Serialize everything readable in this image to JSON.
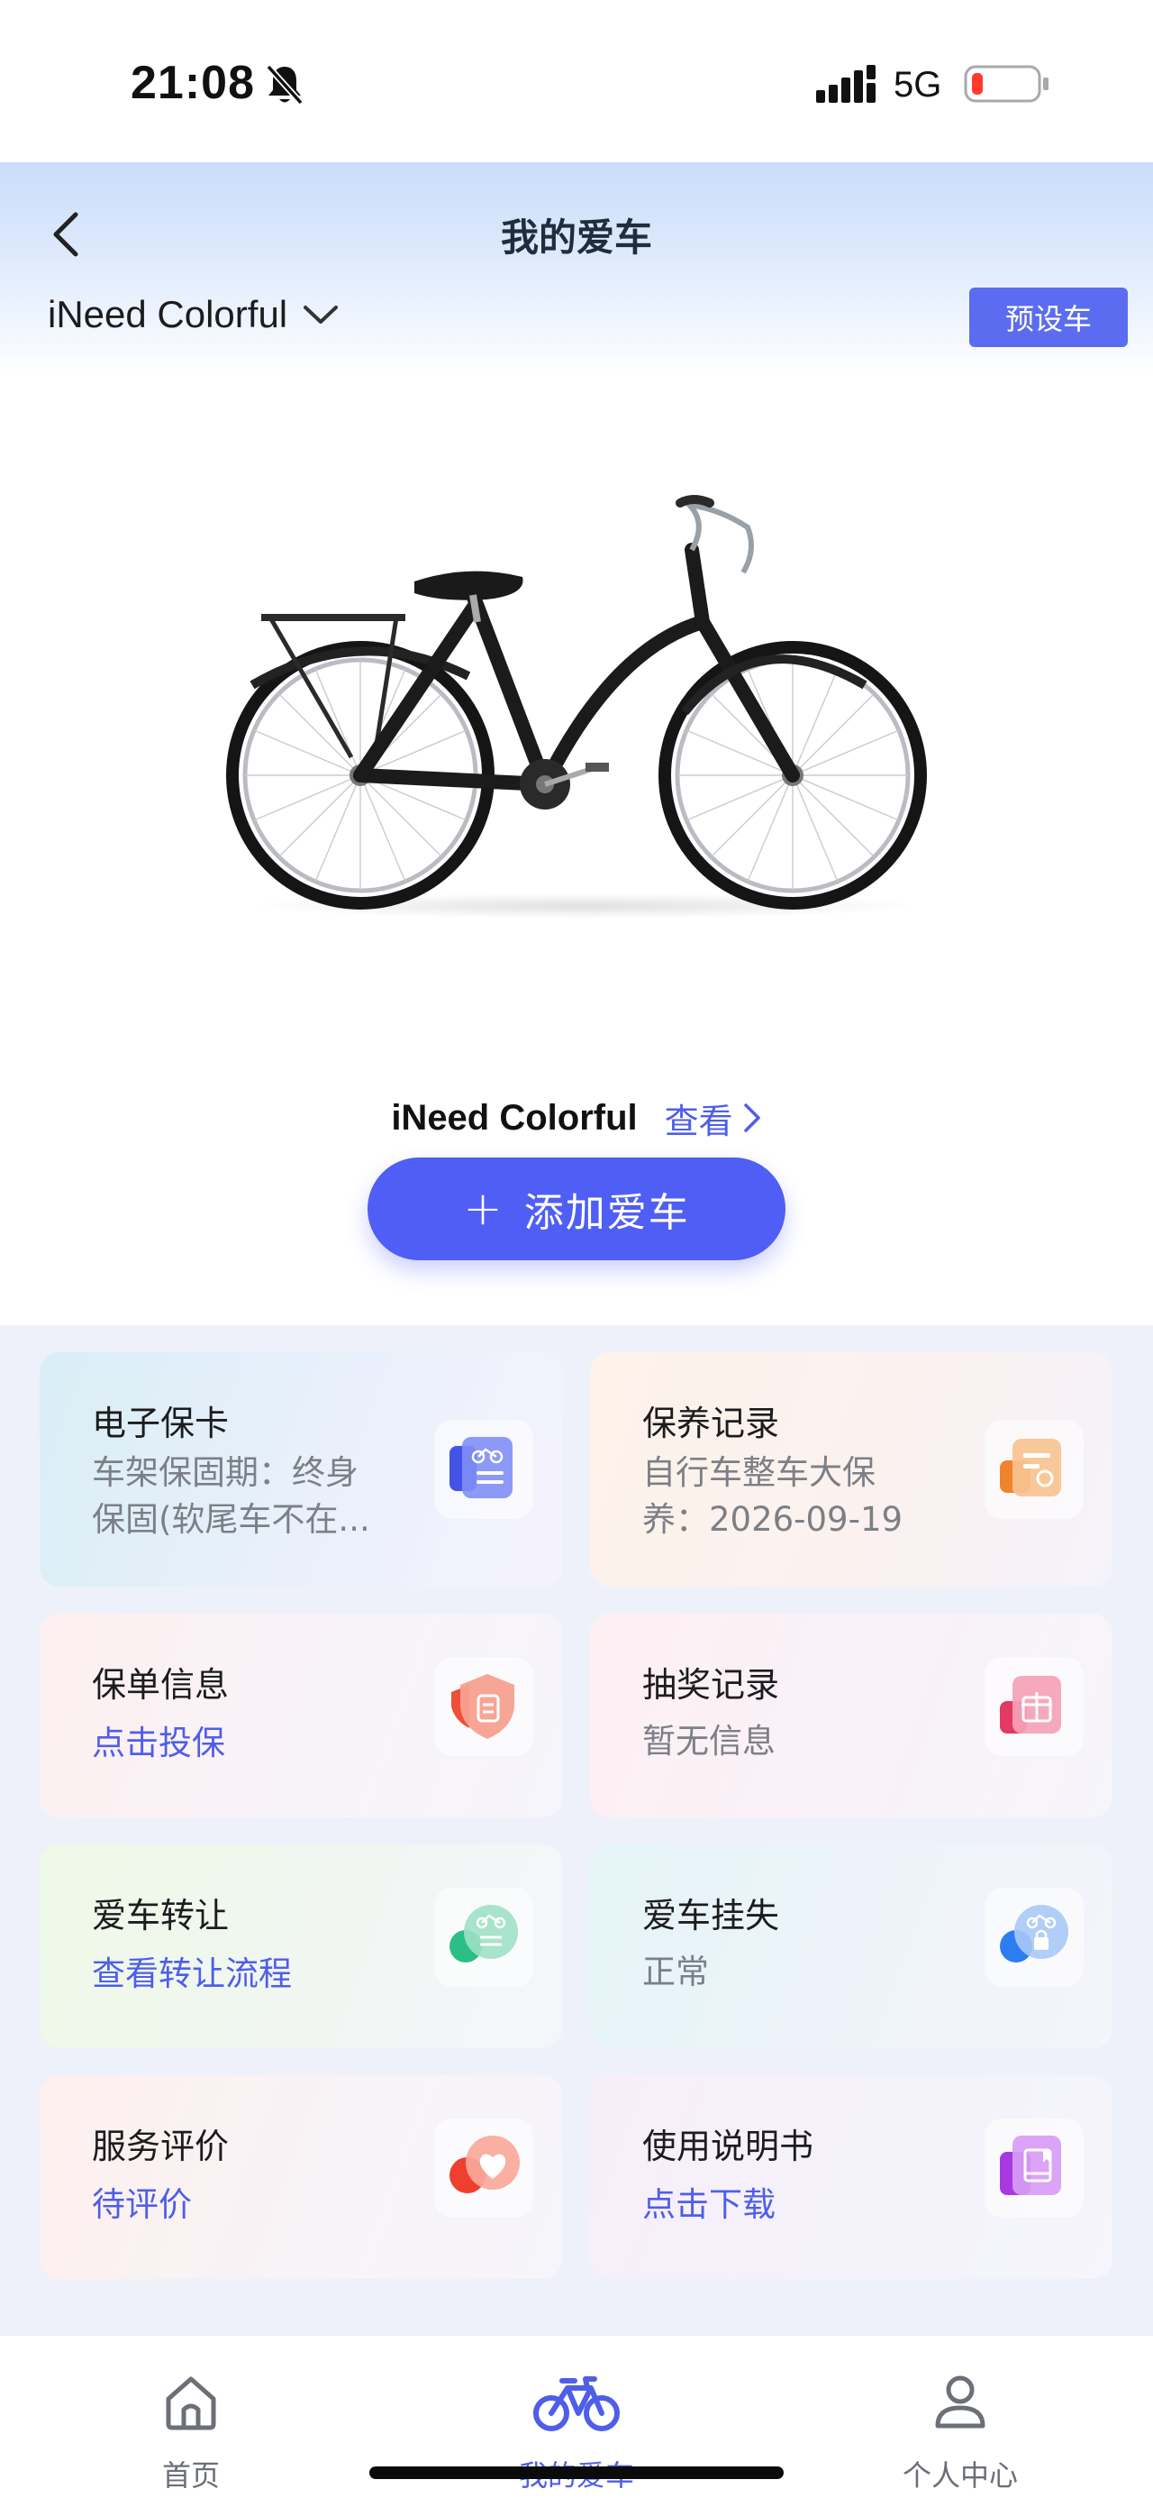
{
  "status_bar": {
    "time": "21:08",
    "network": "5G"
  },
  "header": {
    "title": "我的爱车",
    "bike_selector": "iNeed Colorful",
    "preset_button": "预设车"
  },
  "bike": {
    "name": "iNeed Colorful",
    "view_link": "查看",
    "add_button": "添加爱车"
  },
  "cards": [
    {
      "title": "电子保卡",
      "subtitle": "车架保固期：终身保固(软尾车不在...",
      "icon": "bike-card-icon",
      "accent": "#5b6cf0"
    },
    {
      "title": "保养记录",
      "subtitle": "自行车整车大保养：2026-09-19",
      "icon": "maintenance-icon",
      "accent": "#f29a4a"
    },
    {
      "title": "保单信息",
      "subtitle": "点击投保",
      "icon": "insurance-shield-icon",
      "accent": "#ee6a57"
    },
    {
      "title": "抽奖记录",
      "subtitle": "暂无信息",
      "icon": "gift-icon",
      "accent": "#e8668a"
    },
    {
      "title": "爱车转让",
      "subtitle": "查看转让流程",
      "icon": "transfer-icon",
      "accent": "#3fc28f"
    },
    {
      "title": "爱车挂失",
      "subtitle": "正常",
      "icon": "report-loss-icon",
      "accent": "#3f8ff0"
    },
    {
      "title": "服务评价",
      "subtitle": "待评价",
      "icon": "heart-rating-icon",
      "accent": "#f0645a"
    },
    {
      "title": "使用说明书",
      "subtitle": "点击下载",
      "icon": "manual-book-icon",
      "accent": "#b253e6"
    }
  ],
  "nav": {
    "home": "首页",
    "my_bike": "我的爱车",
    "profile": "个人中心"
  },
  "colors": {
    "primary": "#4f5ef4",
    "link": "#4f5ee8"
  }
}
